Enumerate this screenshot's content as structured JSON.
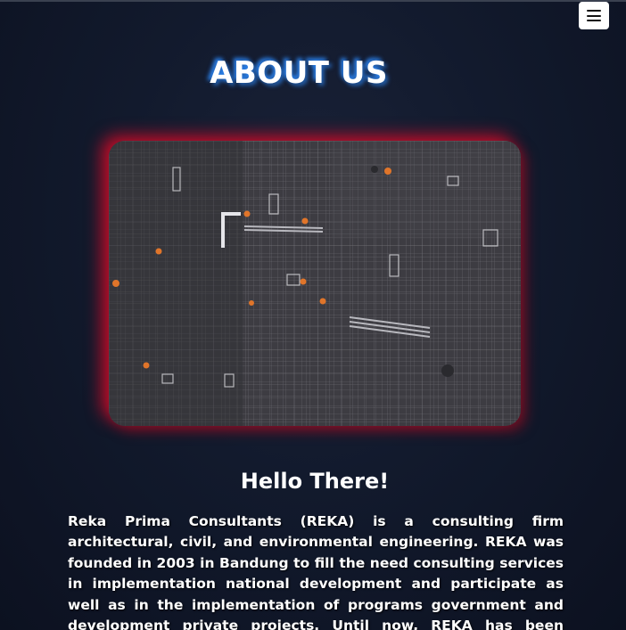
{
  "header": {
    "menu_icon": "hamburger-menu-icon"
  },
  "about": {
    "title": "ABOUT US",
    "image_icon": "construction-site-aerial-photo",
    "greeting": "Hello There!",
    "intro": "Reka Prima Consultants (REKA) is a consulting firm architectural, civil, and environmental engineering. REKA was founded in 2003 in Bandung to fill the need consulting services in implementation national development and participate as well as in the implementation of programs government and development private projects. Until now, REKA has been working on various projects from the Government and"
  },
  "colors": {
    "background": "#121a2d",
    "title_glow": "#2d8cff",
    "image_glow": "#dc0a28",
    "text": "#ffffff"
  }
}
